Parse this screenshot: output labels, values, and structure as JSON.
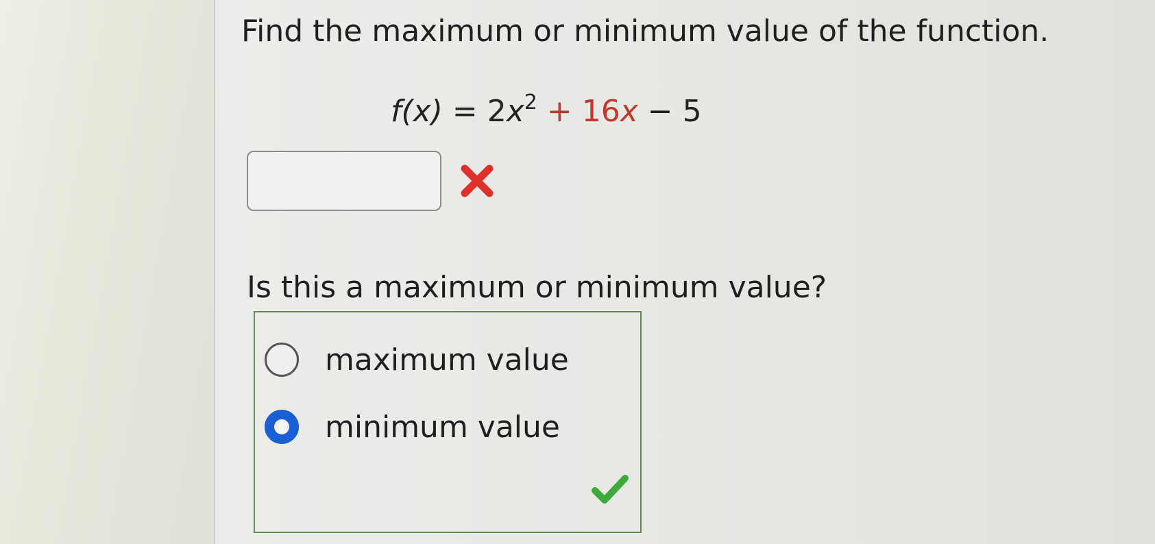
{
  "question": {
    "title": "Find the maximum or minimum value of the function.",
    "formula": {
      "lhs": "f(x)",
      "eq": " = 2",
      "x1": "x",
      "exp": "2",
      "plus_coef": " + 16",
      "x2": "x",
      "rest": " − 5"
    }
  },
  "answer_field": {
    "value": "",
    "status_icon": "x-mark-icon",
    "status_color": "#e0302c"
  },
  "sub_question": {
    "text": "Is this a maximum or minimum value?",
    "options": [
      {
        "label": "maximum value",
        "selected": false
      },
      {
        "label": "minimum value",
        "selected": true
      }
    ],
    "status_icon": "check-mark-icon",
    "status_color": "#3fa93a",
    "box_border_color": "#5e8f4f",
    "radio_selected_color": "#1a5fd6"
  }
}
